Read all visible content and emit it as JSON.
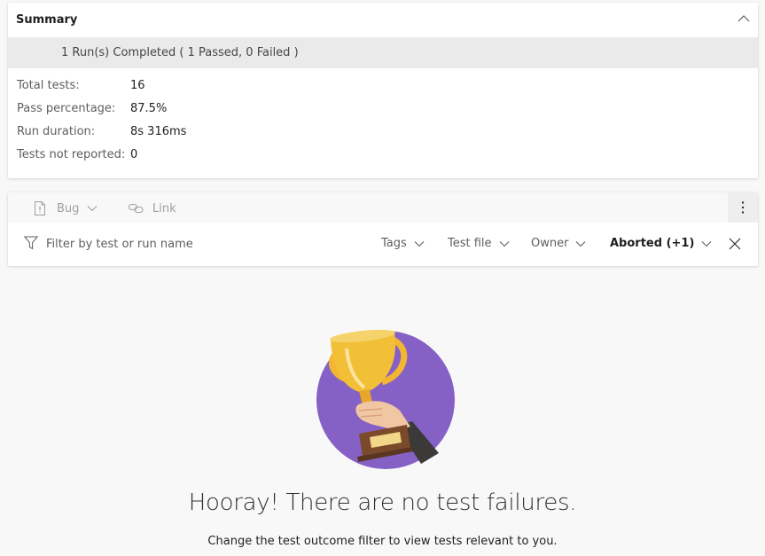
{
  "summary": {
    "title": "Summary",
    "run_status": "1 Run(s) Completed ( 1 Passed, 0 Failed )",
    "stats": [
      {
        "label": "Total tests:",
        "value": "16"
      },
      {
        "label": "Pass percentage:",
        "value": "87.5%"
      },
      {
        "label": "Run duration:",
        "value": "8s 316ms"
      },
      {
        "label": "Tests not reported:",
        "value": "0"
      }
    ]
  },
  "toolbar": {
    "bug_label": "Bug",
    "link_label": "Link"
  },
  "filters": {
    "search_placeholder": "Filter by test or run name",
    "tags_label": "Tags",
    "test_file_label": "Test file",
    "owner_label": "Owner",
    "outcome_label": "Aborted (+1)"
  },
  "empty_state": {
    "heading": "Hooray! There are no test failures.",
    "subtext": "Change the test outcome filter to view tests relevant to you."
  },
  "colors": {
    "accent_purple": "#8661c5",
    "trophy_gold": "#f2c037",
    "toolbar_disabled": "#a19f9d"
  }
}
